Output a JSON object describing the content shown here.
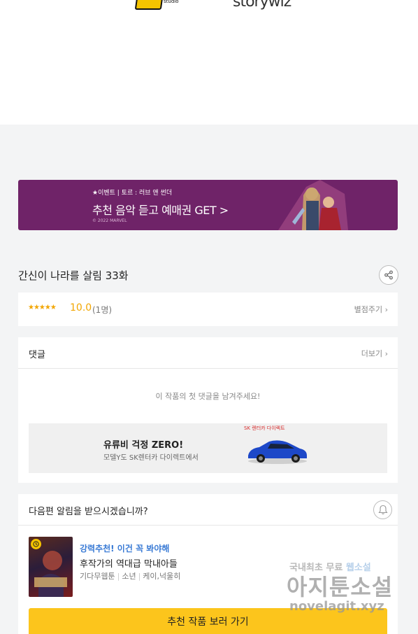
{
  "header": {
    "logos": [
      {
        "name": "dbox studio",
        "text": "studio"
      },
      {
        "name": "storywiz",
        "text": "storywiz"
      }
    ]
  },
  "banner": {
    "event_text": "★이벤트 | 토르 : 러브 앤 썬더",
    "main_text": "추천 음악 듣고 예매권 GET >",
    "copyright": "© 2022 MARVEL",
    "bg_color": "#6f2368"
  },
  "episode": {
    "title": "간신이 나라를 살림 33화"
  },
  "rating": {
    "stars": "★★★★★",
    "score": "10.0",
    "count": "(1명)",
    "rate_link": "별점주기 ›",
    "star_color": "#f2a600"
  },
  "comments": {
    "title": "댓글",
    "more": "더보기 ›",
    "empty_message": "이 작품의 첫 댓글을 남겨주세요!"
  },
  "ad": {
    "headline": "유류비 걱정 ZERO!",
    "sub": "모델Y도 SK렌터카 다이렉트에서",
    "brand": "SK 렌터카 다이렉트"
  },
  "next_alert": {
    "question": "다음편 알림을 받으시겠습니까?",
    "rec_label": "강력추천! 이건 꼭 봐야해",
    "rec_title": "후작가의 역대급 막내아들",
    "meta": [
      "기다무웹툰",
      "소년",
      "케이,넉울히"
    ],
    "cta": "추천 작품 보러 가기",
    "cta_color": "#fcc51c"
  },
  "watermark": {
    "line1_a": "국내최초 무료 ",
    "line1_b": "웹소설",
    "line2": "아지툰소설",
    "line3": "novelagit.xyz"
  }
}
